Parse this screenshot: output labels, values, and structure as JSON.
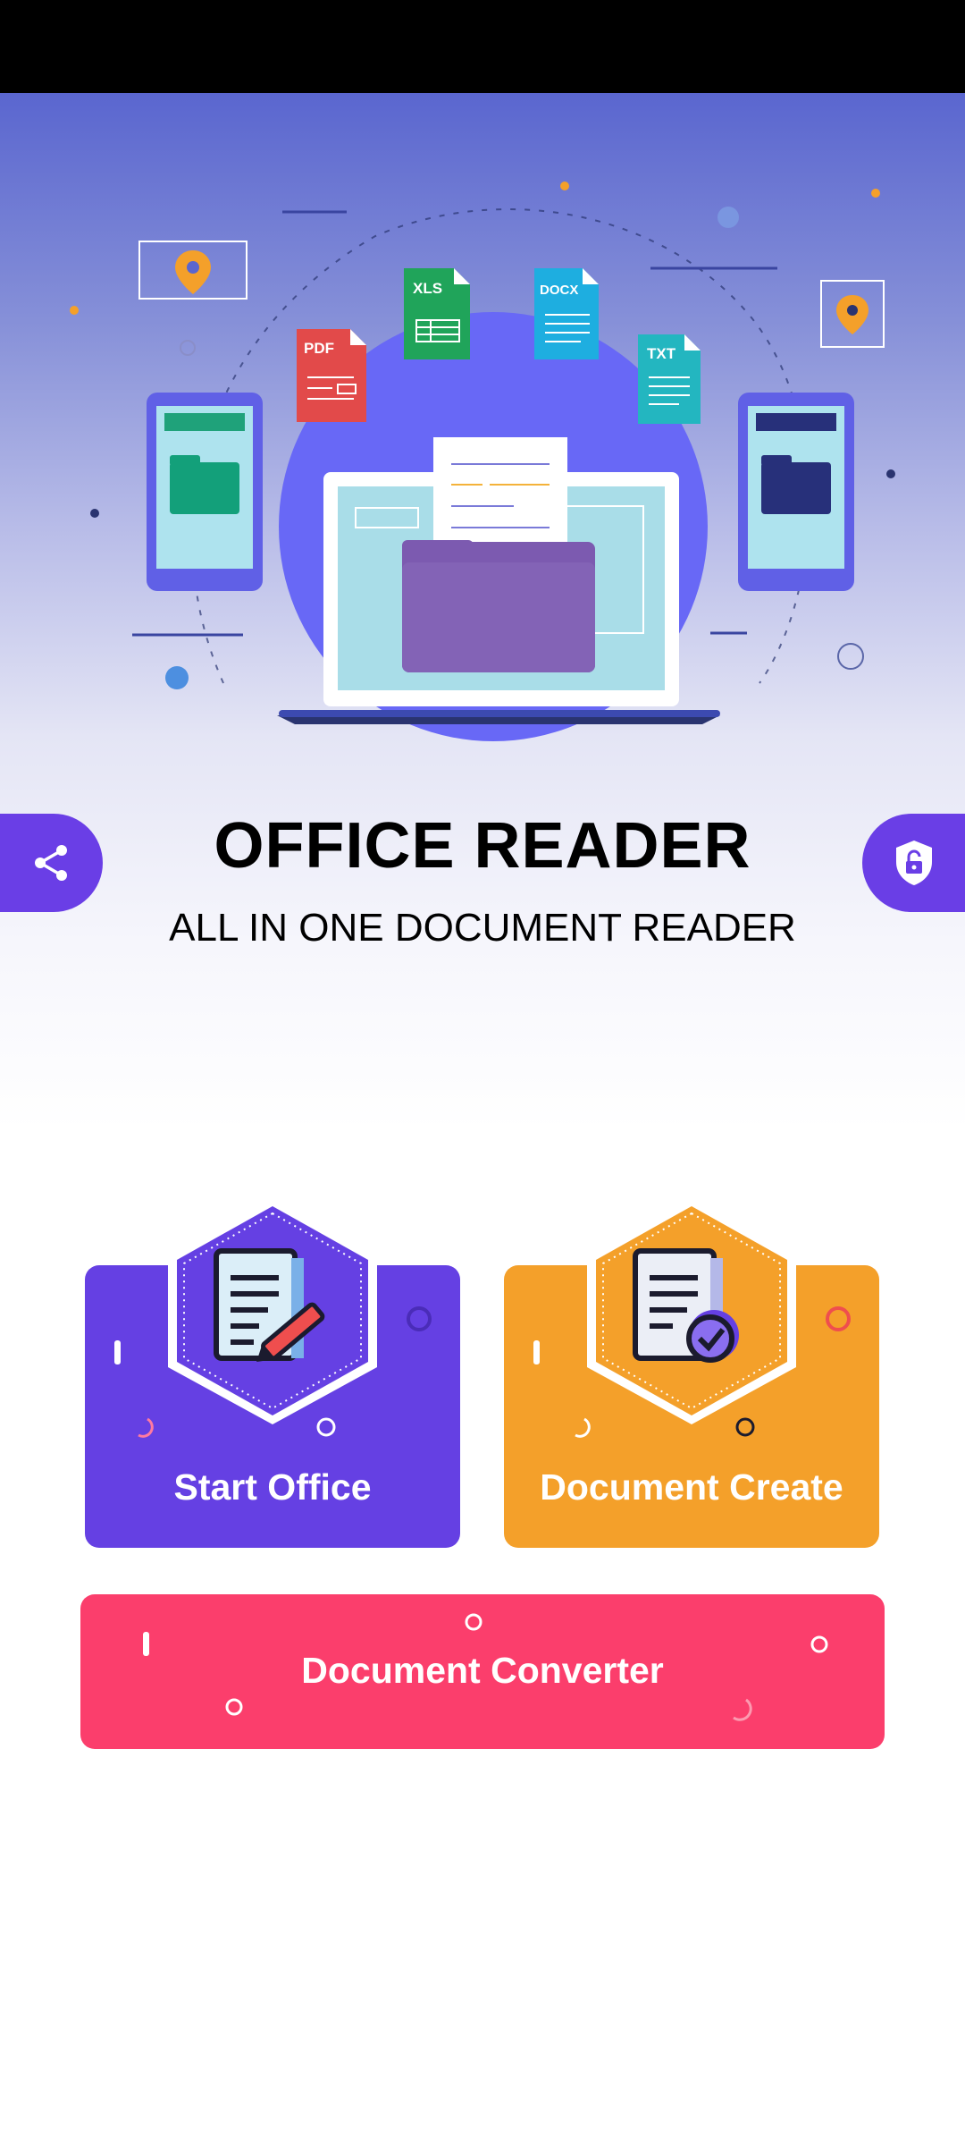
{
  "hero": {
    "file_tags": [
      "PDF",
      "XLS",
      "DOCX",
      "TXT"
    ]
  },
  "header": {
    "title": "OFFICE READER",
    "subtitle": "ALL IN ONE DOCUMENT READER"
  },
  "actions": {
    "share_icon": "share-icon",
    "privacy_icon": "shield-lock-icon"
  },
  "cards": {
    "start_office": "Start Office",
    "document_create": "Document Create",
    "document_converter": "Document Converter"
  },
  "colors": {
    "primary": "#6540e3",
    "accent_orange": "#f4a02a",
    "accent_pink": "#fb3e6c"
  }
}
